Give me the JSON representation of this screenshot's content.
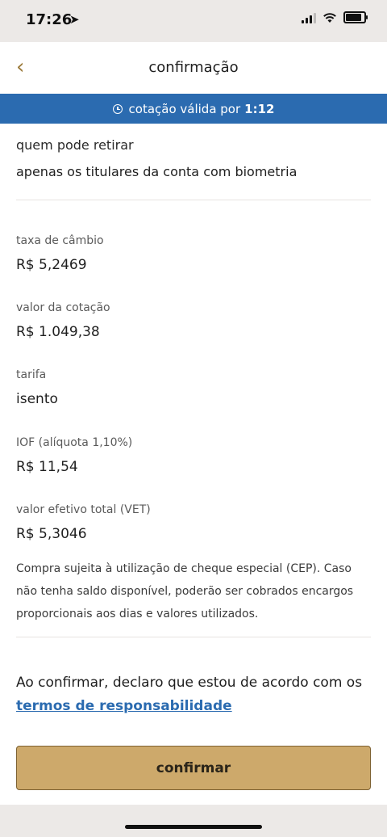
{
  "status_bar": {
    "time": "17:26",
    "location_icon": "location-arrow-icon",
    "icons": [
      "signal-icon",
      "wifi-icon",
      "battery-icon"
    ]
  },
  "nav": {
    "back_icon": "chevron-left-icon",
    "title": "confirmação"
  },
  "banner": {
    "icon": "clock-icon",
    "text": "cotação válida por",
    "time": "1:12",
    "color": "#2b6bb0"
  },
  "withdraw": {
    "label": "quem pode retirar",
    "value": "apenas os titulares da conta com biometria"
  },
  "fields": [
    {
      "label": "taxa de câmbio",
      "value": "R$ 5,2469"
    },
    {
      "label": "valor da cotação",
      "value": "R$ 1.049,38"
    },
    {
      "label": "tarifa",
      "value": "isento"
    },
    {
      "label": "IOF (alíquota 1,10%)",
      "value": "R$ 11,54"
    },
    {
      "label": "valor efetivo total (VET)",
      "value": "R$ 5,3046"
    }
  ],
  "note": {
    "line1": "Compra sujeita à utilização de cheque especial (CEP). Caso",
    "line2": "não tenha saldo disponível, poderão ser cobrados encargos",
    "line3": "proporcionais aos dias e valores utilizados."
  },
  "agreement": {
    "text": "Ao confirmar, declaro que estou de acordo com os",
    "link": "termos de responsabilidade"
  },
  "confirm_button": {
    "label": "confirmar",
    "color": "#cda96b"
  }
}
